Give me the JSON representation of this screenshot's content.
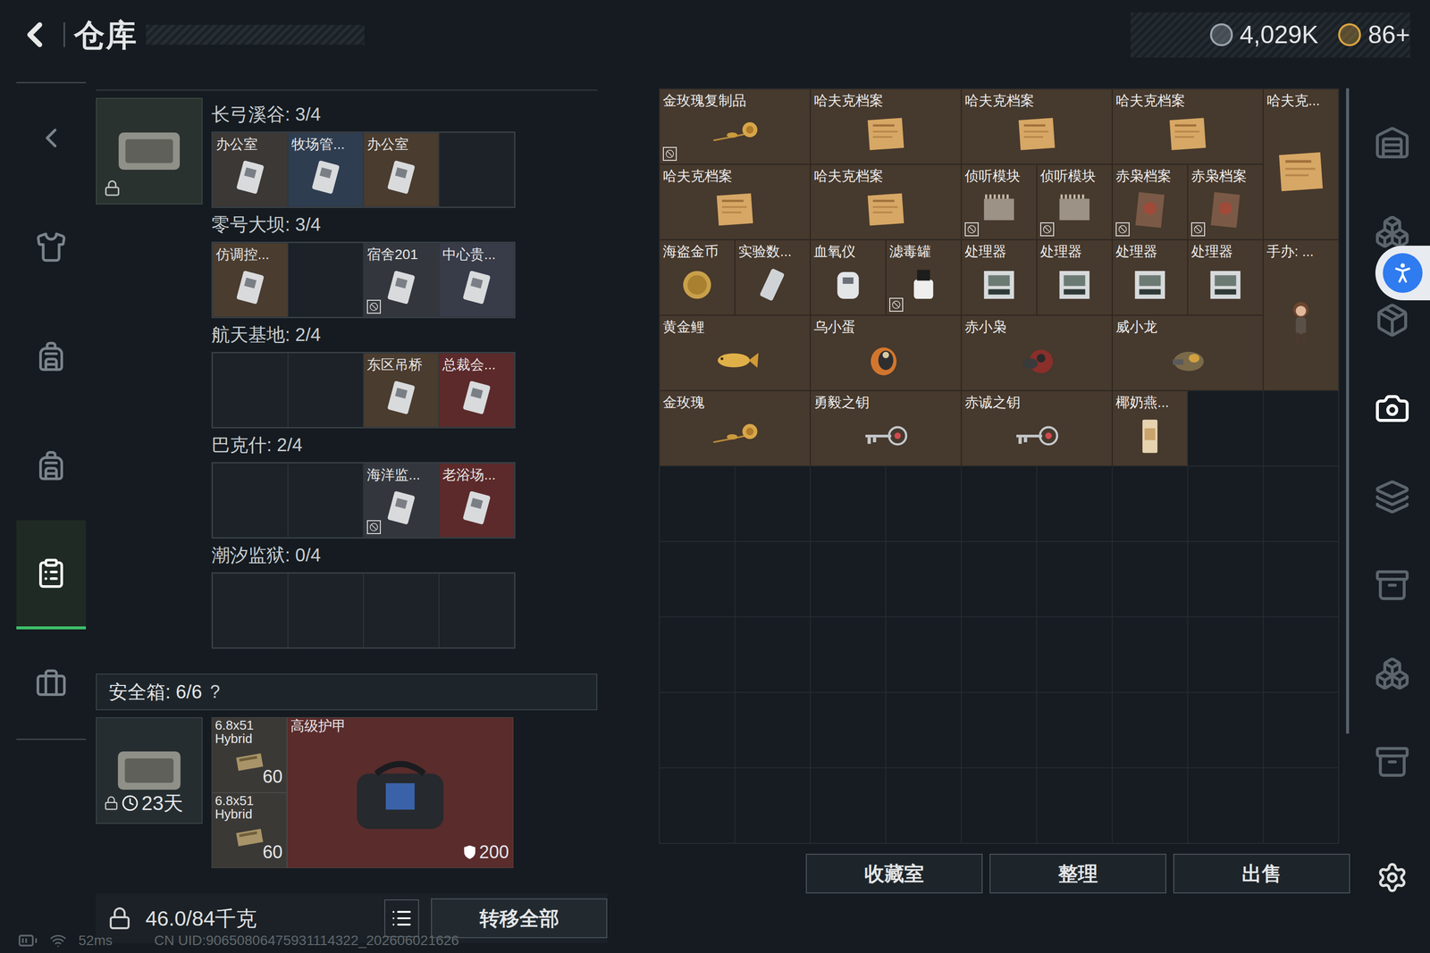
{
  "header": {
    "title": "仓库",
    "currencies": [
      {
        "value": "4,029K",
        "color": "#9aa4ad"
      },
      {
        "value": "86+",
        "color": "#d9a441"
      }
    ]
  },
  "nav_items": [
    {
      "selected": false
    },
    {
      "selected": false
    },
    {
      "selected": false
    },
    {
      "selected": false
    },
    {
      "selected": true
    },
    {
      "selected": false
    }
  ],
  "key_sections": [
    {
      "title": "长弓溪谷: 3/4",
      "slots": [
        {
          "kind": "card",
          "label": "办公室",
          "color": "#3c3835",
          "locked": false
        },
        {
          "kind": "card",
          "label": "牧场管...",
          "color": "#2f3d50",
          "locked": false
        },
        {
          "kind": "card",
          "label": "办公室",
          "color": "#4a3c2f",
          "locked": false
        },
        {
          "kind": "empty",
          "label": "",
          "color": "#1c2227",
          "locked": false
        }
      ]
    },
    {
      "title": "零号大坝: 3/4",
      "slots": [
        {
          "kind": "card",
          "label": "仿调控...",
          "color": "#4a3c2f",
          "locked": false
        },
        {
          "kind": "empty",
          "label": "",
          "color": "#1c2227",
          "locked": false
        },
        {
          "kind": "card",
          "label": "宿舍201",
          "color": "#33373d",
          "locked": true
        },
        {
          "kind": "card",
          "label": "中心贵...",
          "color": "#383b48",
          "locked": false
        }
      ]
    },
    {
      "title": "航天基地: 2/4",
      "slots": [
        {
          "kind": "empty",
          "label": "",
          "color": "#1c2227",
          "locked": false
        },
        {
          "kind": "empty",
          "label": "",
          "color": "#1c2227",
          "locked": false
        },
        {
          "kind": "card",
          "label": "东区吊桥",
          "color": "#4a3c2f",
          "locked": false
        },
        {
          "kind": "card",
          "label": "总裁会...",
          "color": "#5c2a2a",
          "locked": false
        }
      ]
    },
    {
      "title": "巴克什: 2/4",
      "slots": [
        {
          "kind": "empty",
          "label": "",
          "color": "#1c2227",
          "locked": false
        },
        {
          "kind": "empty",
          "label": "",
          "color": "#1c2227",
          "locked": false
        },
        {
          "kind": "card",
          "label": "海洋监...",
          "color": "#33373d",
          "locked": true
        },
        {
          "kind": "card",
          "label": "老浴场...",
          "color": "#5c2a2a",
          "locked": false
        }
      ]
    },
    {
      "title": "潮汐监狱: 0/4",
      "slots": [
        {
          "kind": "empty",
          "label": "",
          "color": "#1c2227",
          "locked": false
        },
        {
          "kind": "empty",
          "label": "",
          "color": "#1c2227",
          "locked": false
        },
        {
          "kind": "empty",
          "label": "",
          "color": "#1c2227",
          "locked": false
        },
        {
          "kind": "empty",
          "label": "",
          "color": "#1c2227",
          "locked": false
        }
      ]
    }
  ],
  "safe_box": {
    "title": "安全箱: 6/6",
    "help": "?",
    "timer": "23天",
    "items": [
      {
        "kind": "ammo",
        "name": "6.8x51 Hybrid",
        "count": "60",
        "color": "#3b3936"
      },
      {
        "kind": "ammo",
        "name": "6.8x51 Hybrid",
        "count": "60",
        "color": "#3b3936"
      },
      {
        "kind": "armor",
        "name": "高级护甲",
        "count": "200",
        "color": "#5a2c2c"
      }
    ]
  },
  "weight": "46.0/84千克",
  "transfer_button": "转移全部",
  "stash": [
    {
      "kind": "rose",
      "name": "金玫瑰复制品",
      "locked": true
    },
    {
      "kind": "file",
      "name": "哈夫克档案",
      "locked": false
    },
    {
      "kind": "file",
      "name": "哈夫克档案",
      "locked": false
    },
    {
      "kind": "file",
      "name": "哈夫克档案",
      "locked": false
    },
    {
      "kind": "file-tall",
      "name": "哈夫克...",
      "locked": false
    },
    {
      "kind": "file",
      "name": "哈夫克档案",
      "locked": false
    },
    {
      "kind": "file",
      "name": "哈夫克档案",
      "locked": false
    },
    {
      "kind": "module",
      "name": "侦听模块",
      "locked": true
    },
    {
      "kind": "module",
      "name": "侦听模块",
      "locked": true
    },
    {
      "kind": "dossier",
      "name": "赤枭档案",
      "locked": true
    },
    {
      "kind": "dossier",
      "name": "赤枭档案",
      "locked": true
    },
    {
      "kind": "coin",
      "name": "海盗金币",
      "locked": false
    },
    {
      "kind": "data",
      "name": "实验数...",
      "locked": false
    },
    {
      "kind": "oximeter",
      "name": "血氧仪",
      "locked": false
    },
    {
      "kind": "canister",
      "name": "滤毒罐",
      "locked": true
    },
    {
      "kind": "cpu",
      "name": "处理器",
      "locked": false
    },
    {
      "kind": "cpu",
      "name": "处理器",
      "locked": false
    },
    {
      "kind": "cpu",
      "name": "处理器",
      "locked": false
    },
    {
      "kind": "cpu",
      "name": "处理器",
      "locked": false
    },
    {
      "kind": "figure",
      "name": "手办: ...",
      "locked": false
    },
    {
      "kind": "fish",
      "name": "黄金鲤",
      "locked": false
    },
    {
      "kind": "egg",
      "name": "乌小蛋",
      "locked": false
    },
    {
      "kind": "owl",
      "name": "赤小枭",
      "locked": false
    },
    {
      "kind": "dragon",
      "name": "威小龙",
      "locked": false
    },
    {
      "kind": "rose",
      "name": "金玫瑰",
      "locked": false
    },
    {
      "kind": "key",
      "name": "勇毅之钥",
      "locked": false
    },
    {
      "kind": "key",
      "name": "赤诚之钥",
      "locked": false
    },
    {
      "kind": "drink",
      "name": "椰奶燕...",
      "locked": false
    }
  ],
  "stash_buttons": [
    "收藏室",
    "整理",
    "出售"
  ],
  "side_tools": [
    {
      "selected": false
    },
    {
      "selected": false
    },
    {
      "selected": false
    },
    {
      "selected": true
    },
    {
      "selected": false
    },
    {
      "selected": false
    },
    {
      "selected": false
    },
    {
      "selected": false
    }
  ],
  "status_bar": {
    "ping": "52ms",
    "uid": "CN UID:90650806475931114322_202606021626"
  }
}
